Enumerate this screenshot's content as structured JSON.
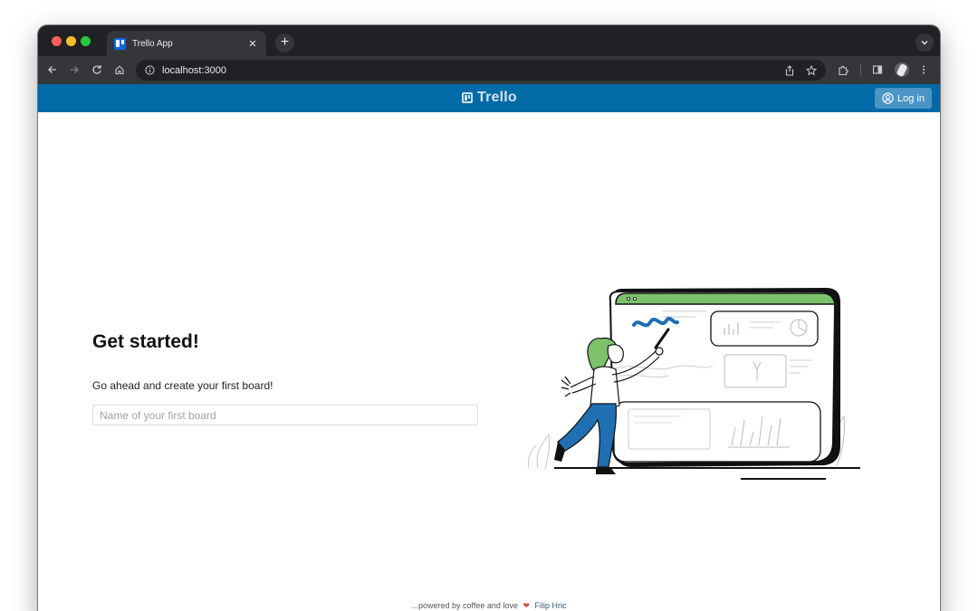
{
  "browser": {
    "tab_title": "Trello App",
    "tab_close": "✕",
    "new_tab": "+",
    "url": "localhost:3000"
  },
  "app": {
    "brand_name": "Trello",
    "login_label": "Log in",
    "colors": {
      "header": "#026aa7",
      "login_button": "#4b95c6",
      "accent_green": "#7cc26b",
      "accent_blue": "#1f6fb2"
    }
  },
  "main": {
    "heading": "Get started!",
    "subtitle": "Go ahead and create your first board!",
    "input_placeholder": "Name of your first board",
    "input_value": ""
  },
  "footer": {
    "prefix": "...powered by coffee and love",
    "heart": "❤",
    "author": "Filip Hric"
  },
  "icons": {
    "back": "arrow-left-icon",
    "forward": "arrow-right-icon",
    "reload": "reload-icon",
    "home": "home-icon",
    "site_info": "info-icon",
    "share": "share-icon",
    "bookmark": "star-icon",
    "extensions": "puzzle-icon",
    "side_panel": "side-panel-icon",
    "profile": "avatar",
    "menu": "kebab-menu-icon",
    "tab_search": "chevron-down-icon",
    "login": "user-circle-icon"
  }
}
